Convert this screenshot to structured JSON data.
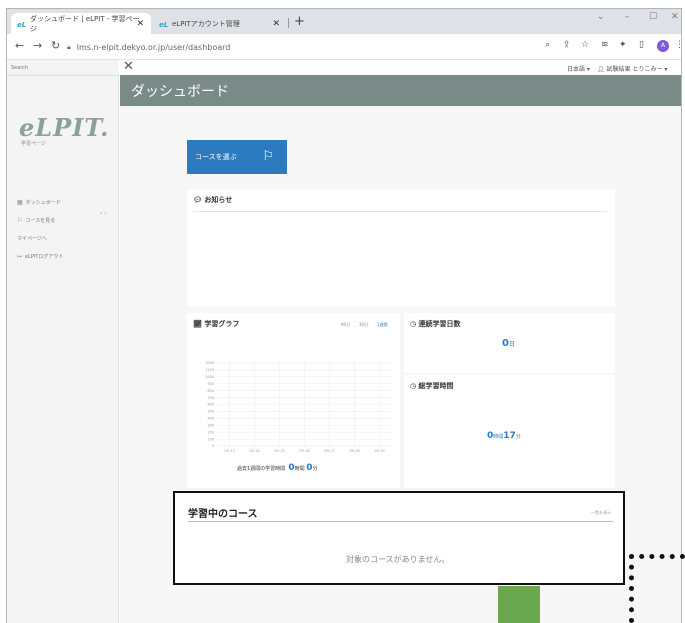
{
  "browser": {
    "tabs": [
      {
        "favicon": "eL",
        "title": "ダッシュボード | eLPIT - 学習ページ"
      },
      {
        "favicon": "eL",
        "title": "eLPITアカウント管理"
      }
    ],
    "url": "lms.n-elpit.dekyo.or.jp/user/dashboard",
    "profile_initial": "A"
  },
  "sidebar": {
    "search_placeholder": "Search",
    "logo": "eLPIT.",
    "logo_sub": "学習ページ",
    "items": [
      {
        "icon": "dashboard-icon",
        "label": "ダッシュボード"
      },
      {
        "icon": "flag-icon",
        "label": "コースを見る"
      },
      {
        "icon": "",
        "label": "マイページへ"
      },
      {
        "icon": "logout-icon",
        "label": "eLPITログアウト"
      }
    ]
  },
  "topnav": {
    "language": "日本語 ▾",
    "user": "試験結果 とりこみー ▾"
  },
  "page": {
    "title": "ダッシュボード",
    "course_button": "コースを選ぶ"
  },
  "news": {
    "title": "お知らせ"
  },
  "graph": {
    "title": "学習グラフ",
    "ranges": [
      "90日",
      "30日",
      "1週間"
    ],
    "y_ticks": [
      "1000",
      "1100",
      "1000",
      "900",
      "800",
      "700",
      "600",
      "500",
      "400",
      "300",
      "200",
      "100",
      "0"
    ],
    "x_ticks": [
      "09-13",
      "09-14",
      "09-15",
      "09-16",
      "09-17",
      "09-18",
      "09-19"
    ],
    "weekly_label": "過去1週間の学習時間",
    "weekly_hours": "0",
    "weekly_hours_unit": "時間",
    "weekly_minutes": "0",
    "weekly_minutes_unit": "分"
  },
  "days": {
    "title": "連続学習日数",
    "value": "0",
    "unit": "日"
  },
  "total": {
    "title": "総学習時間",
    "hours": "0",
    "hours_unit": "時間",
    "minutes": "17",
    "minutes_unit": "分"
  },
  "studying": {
    "title": "学習中のコース",
    "more": "一覧を表示",
    "empty": "対象のコースがありません。"
  },
  "colors": {
    "accent": "#2c7ac0",
    "header": "#7a8b87",
    "green": "#6aa84f"
  }
}
